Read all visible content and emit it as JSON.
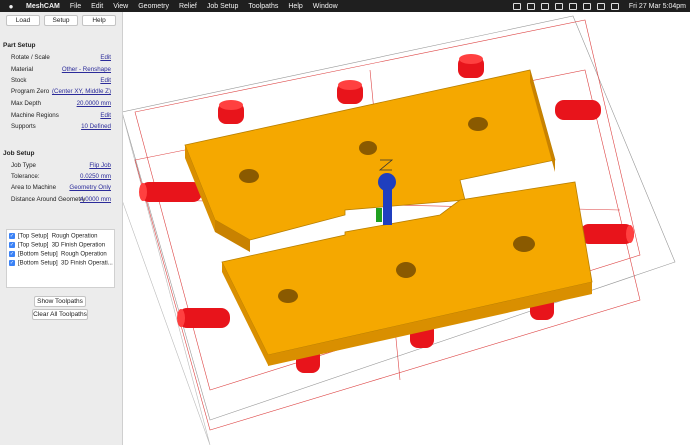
{
  "menubar": {
    "apple": "",
    "app_name": "MeshCAM",
    "menus": [
      "File",
      "Edit",
      "View",
      "Geometry",
      "Relief",
      "Job Setup",
      "Toolpaths",
      "Help",
      "Window"
    ],
    "clock": "Fri 27 Mar  5:04pm"
  },
  "toolbar": {
    "load": "Load",
    "setup": "Setup",
    "help": "Help"
  },
  "part_setup": {
    "title": "Part Setup",
    "rows": [
      {
        "label": "Rotate / Scale",
        "value": "Edit"
      },
      {
        "label": "Material",
        "value": "Other - Renshape"
      },
      {
        "label": "Stock",
        "value": "Edit"
      },
      {
        "label": "Program Zero",
        "value": "(Center XY, Middle Z)"
      },
      {
        "label": "Max Depth",
        "value": "20.0000 mm"
      },
      {
        "label": "Machine Regions",
        "value": "Edit"
      },
      {
        "label": "Supports",
        "value": "10 Defined"
      }
    ]
  },
  "job_setup": {
    "title": "Job Setup",
    "rows": [
      {
        "label": "Job Type",
        "value": "Flip Job"
      },
      {
        "label": "Tolerance:",
        "value": "0.0250 mm"
      },
      {
        "label": "Area to Machine",
        "value": "Geometry Only"
      },
      {
        "label": "Distance Around Geometry",
        "value": "4.0000 mm"
      }
    ]
  },
  "operations": [
    {
      "setup": "[Top Setup]",
      "name": "Rough Operation",
      "checked": true
    },
    {
      "setup": "[Top Setup]",
      "name": "3D Finish Operation",
      "checked": true
    },
    {
      "setup": "[Bottom Setup]",
      "name": "Rough Operation",
      "checked": true
    },
    {
      "setup": "[Bottom Setup]",
      "name": "3D Finish Operati...",
      "checked": true
    }
  ],
  "buttons": {
    "show_toolpaths": "Show Toolpaths",
    "clear_toolpaths": "Clear All Toolpaths"
  },
  "colors": {
    "part": "#f5a800",
    "part_side": "#d98f00",
    "support": "#e8141b",
    "axis": "#1f3fbf",
    "bbox": "#d44"
  }
}
